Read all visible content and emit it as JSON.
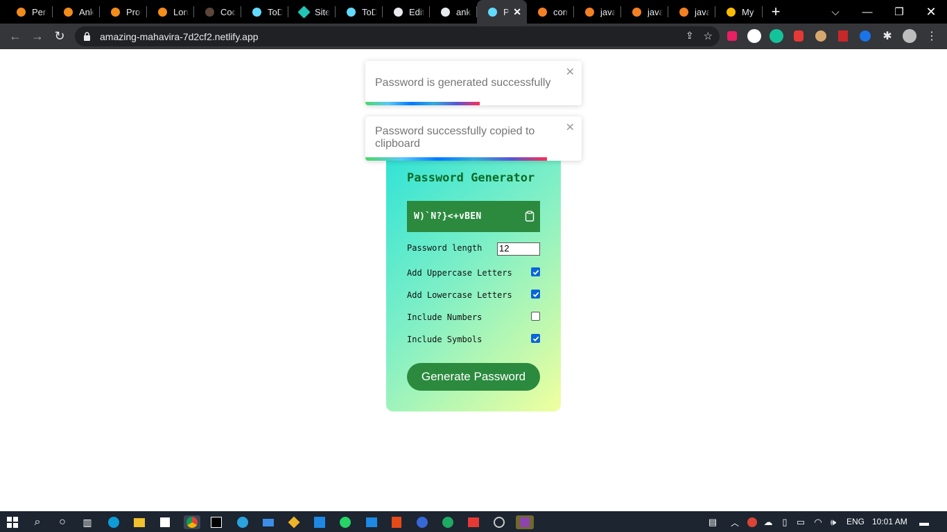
{
  "browser": {
    "tabs": [
      {
        "label": "Perm",
        "icon": "codeforces-icon"
      },
      {
        "label": "Anku",
        "icon": "codeforces-icon"
      },
      {
        "label": "Probl",
        "icon": "codeforces-icon"
      },
      {
        "label": "Long",
        "icon": "codeforces-icon"
      },
      {
        "label": "Code",
        "icon": "codechef-icon"
      },
      {
        "label": "ToDo",
        "icon": "react-icon"
      },
      {
        "label": "Site c",
        "icon": "netlify-icon"
      },
      {
        "label": "ToDo",
        "icon": "react-icon"
      },
      {
        "label": "Editir",
        "icon": "github-icon"
      },
      {
        "label": "anku",
        "icon": "github-icon"
      },
      {
        "label": "Pa",
        "icon": "react-icon"
      },
      {
        "label": "comp",
        "icon": "stackoverflow-icon"
      },
      {
        "label": "java",
        "icon": "stackoverflow-icon"
      },
      {
        "label": "java",
        "icon": "stackoverflow-icon"
      },
      {
        "label": "java",
        "icon": "stackoverflow-icon"
      },
      {
        "label": "My D",
        "icon": "google-drive-icon"
      }
    ],
    "url": "amazing-mahavira-7d2cf2.netlify.app"
  },
  "page": {
    "title": "Password Generator",
    "password": "W)`N?}<+vBEN",
    "length_label": "Password length",
    "length_value": "12",
    "options": [
      {
        "label": "Add Uppercase Letters",
        "checked": true
      },
      {
        "label": "Add Lowercase Letters",
        "checked": true
      },
      {
        "label": "Include Numbers",
        "checked": false
      },
      {
        "label": "Include Symbols",
        "checked": true
      }
    ],
    "generate_label": "Generate Password"
  },
  "toasts": [
    {
      "message": "Password is generated successfully",
      "progress": 0.53
    },
    {
      "message": "Password successfully copied to clipboard",
      "progress": 0.84
    }
  ],
  "taskbar": {
    "lang": "ENG",
    "time": "10:01 AM"
  },
  "colors": {
    "accent_green": "#2b8a3e",
    "title_green": "#0e6a27",
    "checkbox_blue": "#0a66d8"
  }
}
